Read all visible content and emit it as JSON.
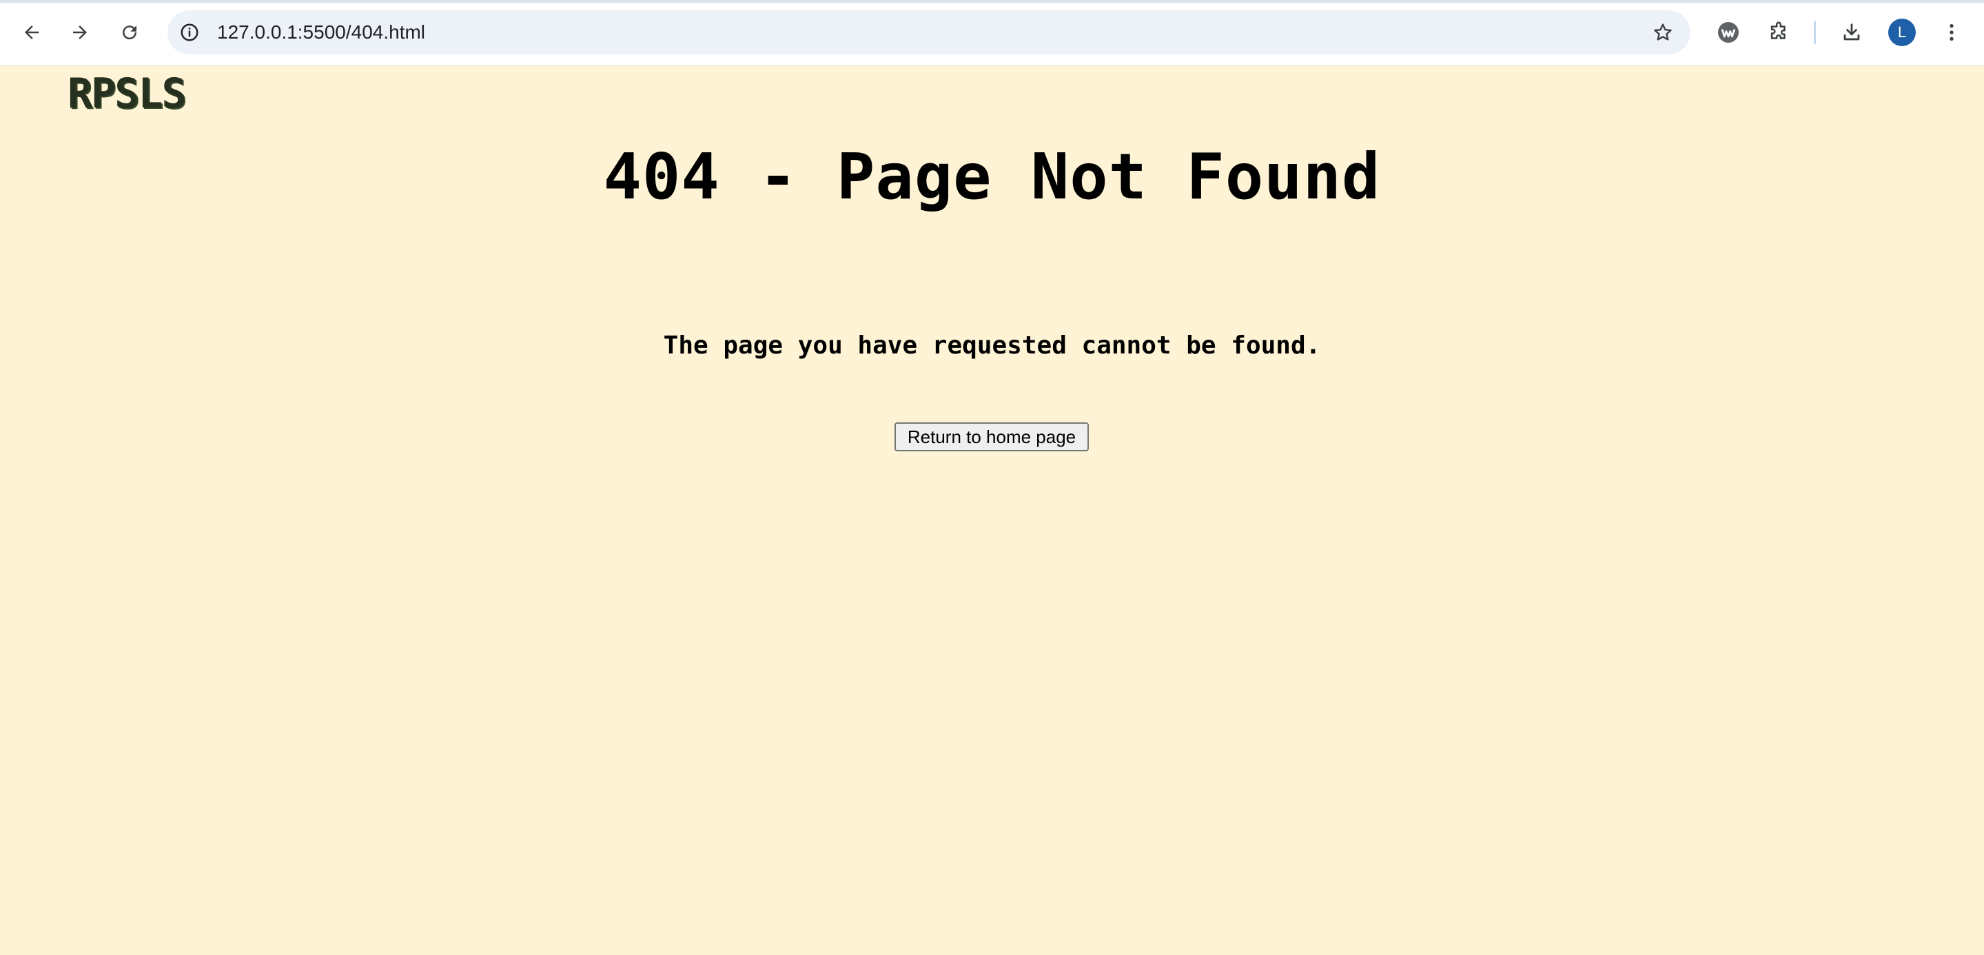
{
  "browser": {
    "url": "127.0.0.1:5500/404.html",
    "profile_initial": "L",
    "icons": {
      "back": "back-arrow-icon",
      "forward": "forward-arrow-icon",
      "reload": "reload-icon",
      "info": "info-icon",
      "bookmark": "star-icon",
      "extension_w": "wappalyzer-icon",
      "extensions": "puzzle-icon",
      "downloads": "download-icon",
      "menu": "kebab-menu-icon"
    },
    "colors": {
      "omnibox_bg": "#edf1f8",
      "avatar_bg": "#1f5fa8"
    }
  },
  "page": {
    "logo": "RPSLS",
    "heading": "404 - Page Not Found",
    "message": "The page you have requested cannot be found.",
    "home_button_label": "Return to home page",
    "colors": {
      "background": "#fef3d4",
      "text": "#000000",
      "logo": "#25301f"
    }
  }
}
